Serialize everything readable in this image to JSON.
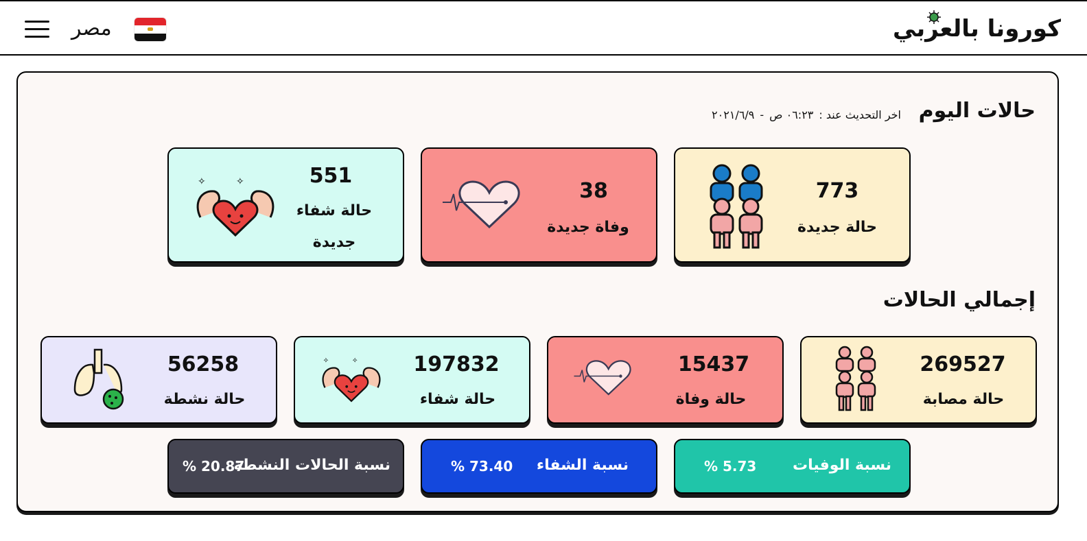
{
  "header": {
    "logo_text": "كورونا بالعربي",
    "country": "مصر",
    "menu_icon": "hamburger-menu-icon",
    "flag_icon": "egypt-flag-icon"
  },
  "today": {
    "title": "حالات اليوم",
    "update_label": "اخر التحديث عند :",
    "update_time": "٠٦:٢٣ ص",
    "update_sep": "-",
    "update_date": "٢٠٢١/٦/٩",
    "new_cases": {
      "value": "773",
      "label": "حالة جديدة",
      "icon": "people-group-icon"
    },
    "new_deaths": {
      "value": "38",
      "label": "وفاة جديدة",
      "icon": "heartbeat-line-icon"
    },
    "new_recovered": {
      "value": "551",
      "label_line1": "حالة شفاء",
      "label_line2": "جديدة",
      "icon": "strong-heart-icon"
    }
  },
  "totals": {
    "title": "إجمالي الحالات",
    "infected": {
      "value": "269527",
      "label": "حالة مصابة",
      "icon": "people-group-icon"
    },
    "deaths": {
      "value": "15437",
      "label": "حالة وفاة",
      "icon": "heartbeat-line-icon"
    },
    "recovered": {
      "value": "197832",
      "label": "حالة شفاء",
      "icon": "strong-heart-icon"
    },
    "active": {
      "value": "56258",
      "label": "حالة نشطة",
      "icon": "lungs-virus-icon"
    }
  },
  "ratios": {
    "deaths": {
      "label": "نسبة الوفيات",
      "value": "% 5.73"
    },
    "recovery": {
      "label": "نسبة الشفاء",
      "value": "% 73.40"
    },
    "active": {
      "label": "نسبة الحالات النشطة",
      "value": "% 20.87"
    }
  },
  "colors": {
    "yellow_card": "#fdf0cc",
    "red_card": "#f98f8d",
    "mint_card": "#d4fbf3",
    "lavender_card": "#e8e6fb",
    "deaths_ratio": "#20c5a9",
    "recovery_ratio": "#1448dd",
    "active_ratio": "#454552"
  }
}
